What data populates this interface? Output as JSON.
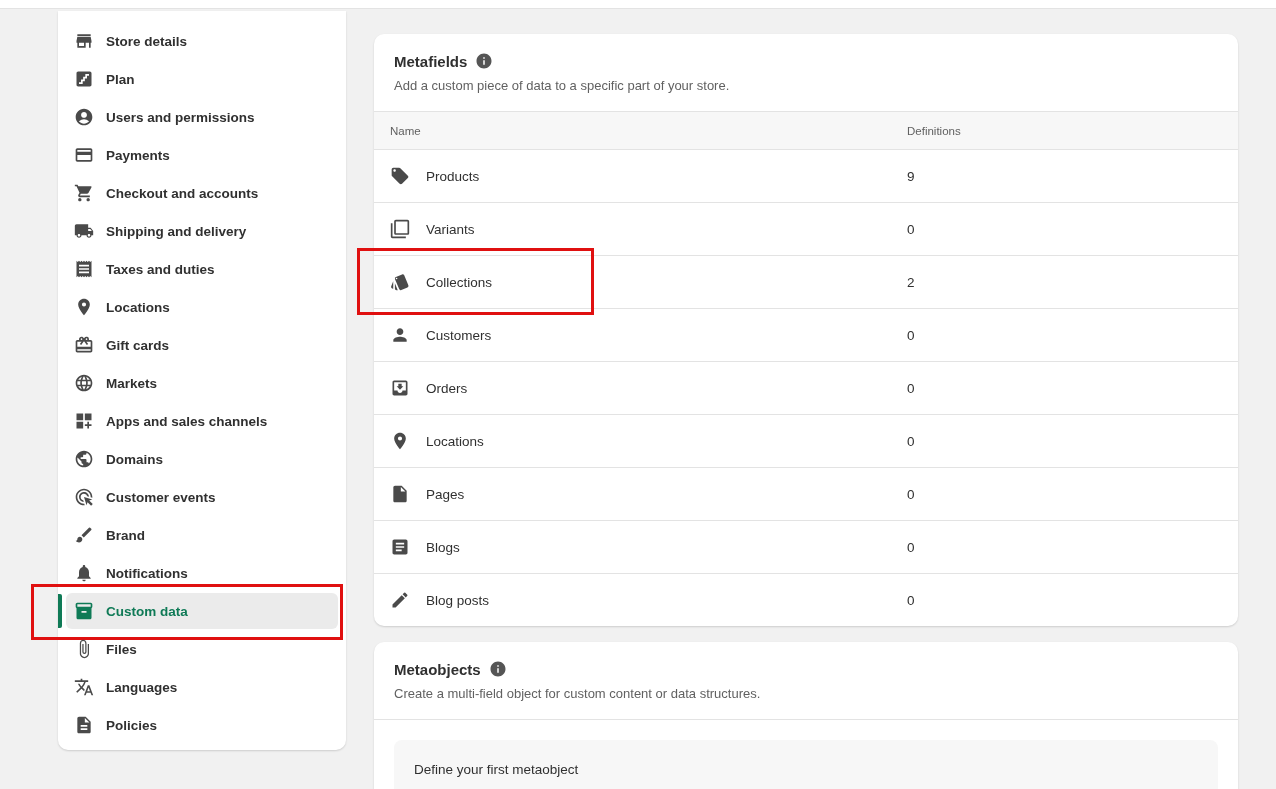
{
  "sidebar": {
    "items": [
      {
        "label": "Store details",
        "selected": false,
        "annotated": false
      },
      {
        "label": "Plan",
        "selected": false,
        "annotated": false
      },
      {
        "label": "Users and permissions",
        "selected": false,
        "annotated": false
      },
      {
        "label": "Payments",
        "selected": false,
        "annotated": false
      },
      {
        "label": "Checkout and accounts",
        "selected": false,
        "annotated": false
      },
      {
        "label": "Shipping and delivery",
        "selected": false,
        "annotated": false
      },
      {
        "label": "Taxes and duties",
        "selected": false,
        "annotated": false
      },
      {
        "label": "Locations",
        "selected": false,
        "annotated": false
      },
      {
        "label": "Gift cards",
        "selected": false,
        "annotated": false
      },
      {
        "label": "Markets",
        "selected": false,
        "annotated": false
      },
      {
        "label": "Apps and sales channels",
        "selected": false,
        "annotated": false
      },
      {
        "label": "Domains",
        "selected": false,
        "annotated": false
      },
      {
        "label": "Customer events",
        "selected": false,
        "annotated": false
      },
      {
        "label": "Brand",
        "selected": false,
        "annotated": false
      },
      {
        "label": "Notifications",
        "selected": false,
        "annotated": false
      },
      {
        "label": "Custom data",
        "selected": true,
        "annotated": true
      },
      {
        "label": "Files",
        "selected": false,
        "annotated": false
      },
      {
        "label": "Languages",
        "selected": false,
        "annotated": false
      },
      {
        "label": "Policies",
        "selected": false,
        "annotated": false
      }
    ]
  },
  "metafields": {
    "title": "Metafields",
    "description": "Add a custom piece of data to a specific part of your store.",
    "table": {
      "columns": [
        "Name",
        "Definitions"
      ],
      "rows": [
        {
          "name": "Products",
          "definitions": "9",
          "annotated": false
        },
        {
          "name": "Variants",
          "definitions": "0",
          "annotated": false
        },
        {
          "name": "Collections",
          "definitions": "2",
          "annotated": true
        },
        {
          "name": "Customers",
          "definitions": "0",
          "annotated": false
        },
        {
          "name": "Orders",
          "definitions": "0",
          "annotated": false
        },
        {
          "name": "Locations",
          "definitions": "0",
          "annotated": false
        },
        {
          "name": "Pages",
          "definitions": "0",
          "annotated": false
        },
        {
          "name": "Blogs",
          "definitions": "0",
          "annotated": false
        },
        {
          "name": "Blog posts",
          "definitions": "0",
          "annotated": false
        }
      ]
    }
  },
  "metaobjects": {
    "title": "Metaobjects",
    "description": "Create a multi-field object for custom content or data structures.",
    "empty_state": {
      "title": "Define your first metaobject"
    }
  }
}
